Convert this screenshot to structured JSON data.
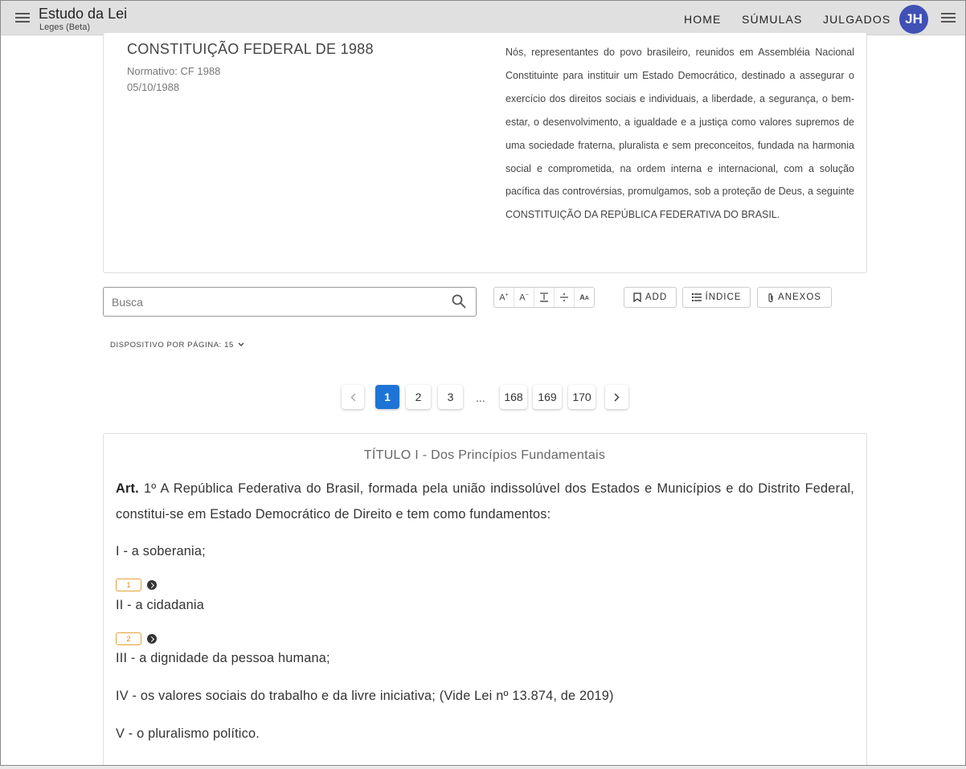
{
  "appbar": {
    "title": "Estudo da Lei",
    "subtitle": "Leges (Beta)",
    "nav": [
      "HOME",
      "SÚMULAS",
      "JULGADOS"
    ],
    "avatar_initials": "JH",
    "avatar_color": "#3f51b5"
  },
  "law": {
    "title": "CONSTITUIÇÃO FEDERAL DE 1988",
    "normative": "Normativo: CF 1988",
    "date": "05/10/1988",
    "preamble": "Nós, representantes do povo brasileiro, reunidos em Assembléia Nacional Constituinte para instituir um Estado Democrático, destinado a assegurar o exercício dos direitos sociais e individuais, a liberdade, a segurança, o bem-estar, o desenvolvimento, a igualdade e a justiça como valores supremos de uma sociedade fraterna, pluralista e sem preconceitos, fundada na harmonia social e comprometida, na ordem interna e internacional, com a solução pacífica das controvérsias, promulgamos, sob a proteção de Deus, a seguinte CONSTITUIÇÃO DA REPÚBLICA FEDERATIVA DO BRASIL."
  },
  "search": {
    "placeholder": "Busca",
    "value": ""
  },
  "toolbar": {
    "font_increase": "A+",
    "font_decrease": "A−",
    "line_spacing_icon": "line-spacing-icon",
    "divide_icon": "divide-icon",
    "text_format": "ᴬ/ₐ",
    "add_label": "ADD",
    "index_label": "ÍNDICE",
    "annex_label": "ANEXOS"
  },
  "per_page": {
    "label": "DISPOSITIVO POR PÁGINA: 15"
  },
  "pagination": {
    "pages": [
      "1",
      "2",
      "3",
      "168",
      "169",
      "170"
    ],
    "current": "1",
    "ellipsis": "...",
    "active_color": "#1e74d6"
  },
  "content": {
    "heading": "TÍTULO I - Dos Princípios Fundamentais",
    "article_label": "Art.",
    "article_text": "1º A República Federativa do Brasil, formada pela união indissolúvel dos Estados e Municípios e do Distrito Federal, constitui-se em Estado Democrático de Direito e tem como fundamentos:",
    "incisos": [
      "I - a soberania;",
      "II - a cidadania",
      "III - a dignidade da pessoa humana;",
      "IV - os valores sociais do trabalho e da livre iniciativa; (Vide Lei nº 13.874, de 2019)",
      "V - o pluralismo político."
    ],
    "chips": [
      "1",
      "2"
    ],
    "chip_color": "#e6a23c"
  }
}
